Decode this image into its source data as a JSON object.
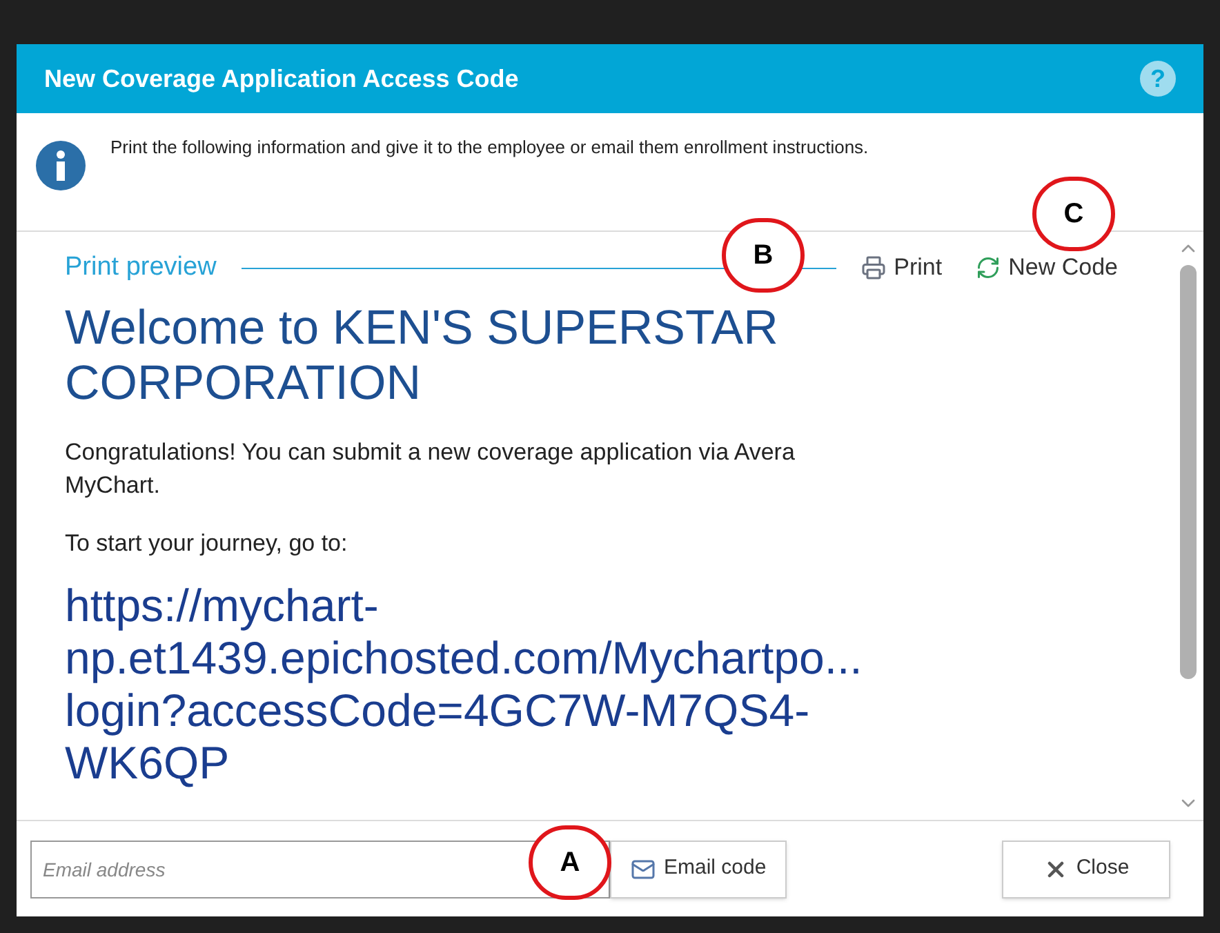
{
  "dialog": {
    "title": "New Coverage Application Access Code",
    "help": "?"
  },
  "info": {
    "text": "Print the following information and give it to the employee or email them enrollment instructions."
  },
  "preview": {
    "label": "Print preview",
    "actions": [
      {
        "kind": "print",
        "label": "Print"
      },
      {
        "kind": "refresh",
        "label": "New Code"
      }
    ],
    "heading_lines": [
      "Welcome to KEN'S SUPERSTAR",
      "CORPORATION"
    ],
    "paragraphs": [
      "Congratulations! You can submit a new coverage application via Avera MyChart.",
      "To start your journey, go to:"
    ],
    "link_lines": [
      "https://mychart-",
      "np.et1439.epichosted.com/Mychartpo...",
      "login?accessCode=4GC7W-M7QS4-",
      "WK6QP"
    ]
  },
  "footer": {
    "email": {
      "placeholder": "Email address"
    },
    "email_button": "Email code",
    "close_button": "Close"
  },
  "callouts": [
    {
      "label": "B"
    },
    {
      "label": "C"
    },
    {
      "label": "A"
    }
  ]
}
